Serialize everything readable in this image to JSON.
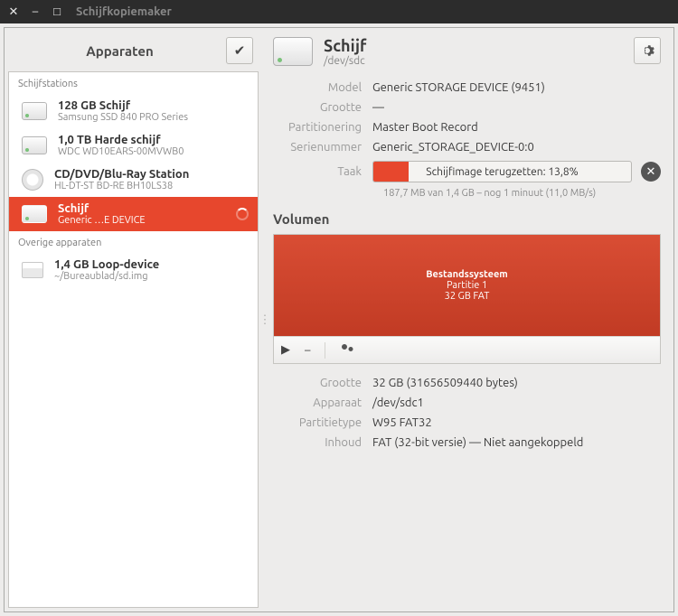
{
  "titlebar": {
    "title": "Schijfkopiemaker"
  },
  "sidebar": {
    "title": "Apparaten",
    "section_drives": "Schijfstations",
    "section_other": "Overige apparaten",
    "drives": [
      {
        "name": "128 GB Schijf",
        "sub": "Samsung SSD 840 PRO Series",
        "icon": "hdd"
      },
      {
        "name": "1,0 TB Harde schijf",
        "sub": "WDC WD10EARS-00MVWB0",
        "icon": "hdd"
      },
      {
        "name": "CD/DVD/Blu-Ray Station",
        "sub": "HL-DT-ST BD-RE  BH10LS38",
        "icon": "disc"
      },
      {
        "name": "Schijf",
        "sub": "Generic …E DEVICE",
        "icon": "hdd",
        "selected": true,
        "busy": true
      }
    ],
    "other": [
      {
        "name": "1,4 GB Loop-device",
        "sub": "~/Bureaublad/sd.img",
        "icon": "loop"
      }
    ]
  },
  "detail": {
    "title": "Schijf",
    "subtitle": "/dev/sdc",
    "kv": {
      "model_k": "Model",
      "model_v": "Generic STORAGE DEVICE (9451)",
      "size_k": "Grootte",
      "size_v": "—",
      "part_k": "Partitionering",
      "part_v": "Master Boot Record",
      "serial_k": "Serienummer",
      "serial_v": "Generic_STORAGE_DEVICE-0:0",
      "task_k": "Taak"
    },
    "task": {
      "label": "Schijfimage terugzetten: 13,8%",
      "percent": 13.8,
      "sub": "187,7 MB van 1,4 GB – nog 1 minuut (11,0 MB/s)"
    },
    "volumes_title": "Volumen",
    "volume": {
      "fs_title": "Bestandssysteem",
      "part_label": "Partitie 1",
      "size_label": "32 GB FAT"
    },
    "vol_kv": {
      "size_k": "Grootte",
      "size_v": "32 GB (31656509440 bytes)",
      "device_k": "Apparaat",
      "device_v": "/dev/sdc1",
      "ptype_k": "Partitietype",
      "ptype_v": "W95 FAT32",
      "content_k": "Inhoud",
      "content_v": "FAT (32-bit versie) — Niet aangekoppeld"
    }
  }
}
